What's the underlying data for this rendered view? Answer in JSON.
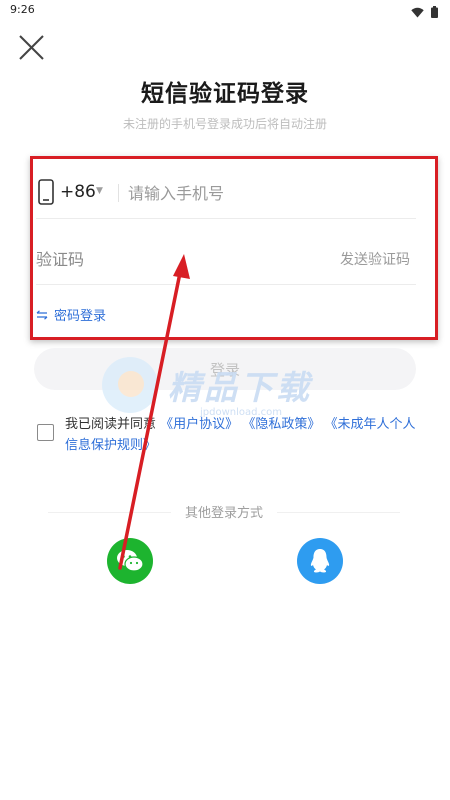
{
  "status_bar": {
    "time": "9:26",
    "wifi_icon": "wifi-icon",
    "battery_icon": "battery-icon"
  },
  "header": {
    "close_icon": "close-icon",
    "title": "短信验证码登录",
    "subtitle": "未注册的手机号登录成功后将自动注册"
  },
  "phone": {
    "country_code": "+86",
    "caret": "▼",
    "placeholder": "请输入手机号",
    "value": ""
  },
  "code": {
    "placeholder": "验证码",
    "value": "",
    "send_label": "发送验证码"
  },
  "password_login": {
    "icon": "swap-icon",
    "label": "密码登录"
  },
  "login_button": {
    "label": "登录"
  },
  "agreement": {
    "checked": false,
    "prefix": "我已阅读并同意",
    "user_agreement": "《用户协议》",
    "privacy_policy": "《隐私政策》",
    "minor_policy": "《未成年人个人信息保护规则》"
  },
  "other_login": {
    "label": "其他登录方式",
    "wechat": {
      "icon": "wechat-icon",
      "color": "#1db42f"
    },
    "qq": {
      "icon": "qq-icon",
      "color": "#2e9cf0"
    }
  },
  "watermark": {
    "text": "精品下载",
    "url": "jpdownload.com"
  },
  "annotation": {
    "box_color": "#d81e24",
    "arrow_color": "#d81e24"
  }
}
